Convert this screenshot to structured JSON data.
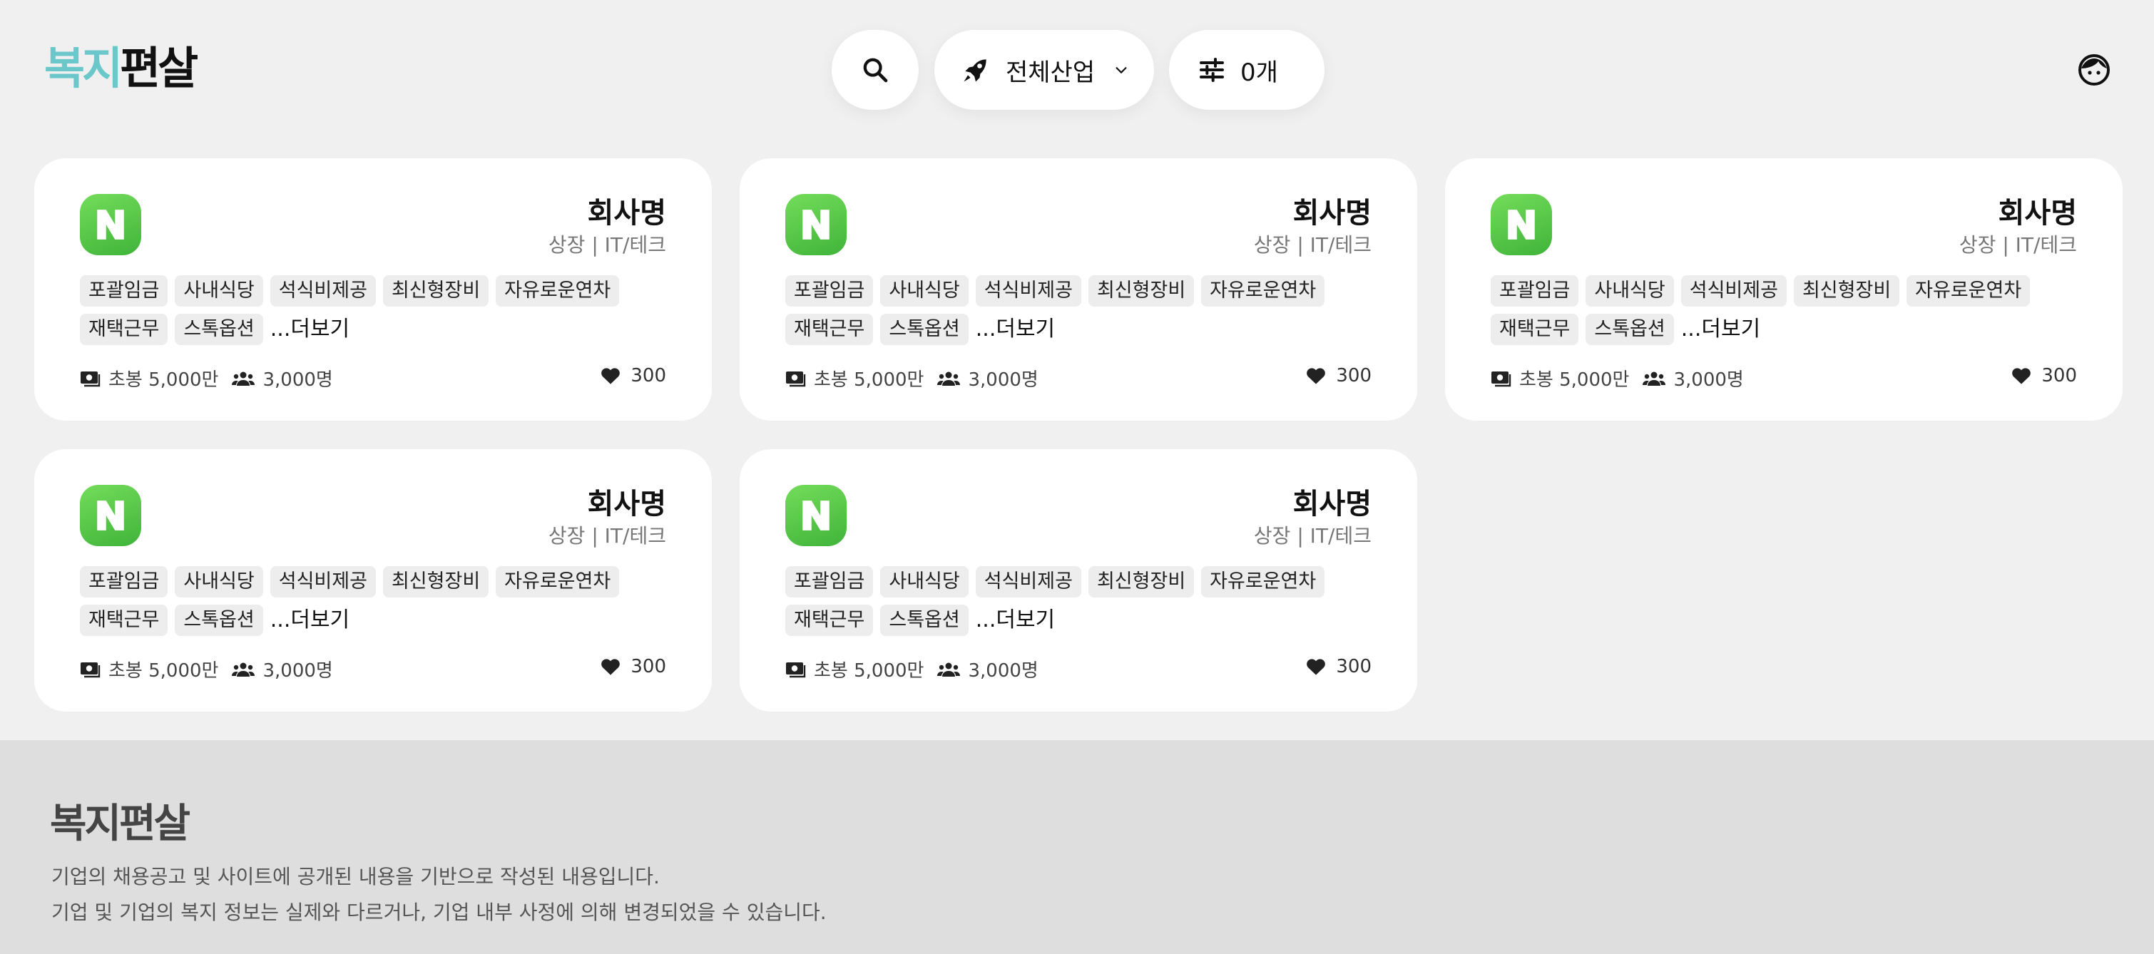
{
  "header": {
    "logo_part1": "복지",
    "logo_part2": "편살",
    "industry_label": "전체산업",
    "filter_label": "0개"
  },
  "cards": [
    {
      "name": "회사명",
      "meta": "상장 | IT/테크",
      "tags": [
        "포괄임금",
        "사내식당",
        "석식비제공",
        "최신형장비",
        "자유로운연차",
        "재택근무",
        "스톡옵션"
      ],
      "more": "...더보기",
      "salary": "초봉 5,000만",
      "employees": "3,000명",
      "likes": "300"
    },
    {
      "name": "회사명",
      "meta": "상장 | IT/테크",
      "tags": [
        "포괄임금",
        "사내식당",
        "석식비제공",
        "최신형장비",
        "자유로운연차",
        "재택근무",
        "스톡옵션"
      ],
      "more": "...더보기",
      "salary": "초봉 5,000만",
      "employees": "3,000명",
      "likes": "300"
    },
    {
      "name": "회사명",
      "meta": "상장 | IT/테크",
      "tags": [
        "포괄임금",
        "사내식당",
        "석식비제공",
        "최신형장비",
        "자유로운연차",
        "재택근무",
        "스톡옵션"
      ],
      "more": "...더보기",
      "salary": "초봉 5,000만",
      "employees": "3,000명",
      "likes": "300"
    },
    {
      "name": "회사명",
      "meta": "상장 | IT/테크",
      "tags": [
        "포괄임금",
        "사내식당",
        "석식비제공",
        "최신형장비",
        "자유로운연차",
        "재택근무",
        "스톡옵션"
      ],
      "more": "...더보기",
      "salary": "초봉 5,000만",
      "employees": "3,000명",
      "likes": "300"
    },
    {
      "name": "회사명",
      "meta": "상장 | IT/테크",
      "tags": [
        "포괄임금",
        "사내식당",
        "석식비제공",
        "최신형장비",
        "자유로운연차",
        "재택근무",
        "스톡옵션"
      ],
      "more": "...더보기",
      "salary": "초봉 5,000만",
      "employees": "3,000명",
      "likes": "300"
    }
  ],
  "footer": {
    "logo": "복지편살",
    "line1": "기업의 채용공고 및 사이트에 공개된 내용을 기반으로 작성된 내용입니다.",
    "line2": "기업 및 기업의 복지 정보는 실제와 다르거나, 기업 내부 사정에 의해 변경되었을 수 있습니다."
  },
  "colors": {
    "accent": "#6cc7cb",
    "naver_green": "#3fb43a",
    "background": "#f0f0f0",
    "footer_bg": "#dedede"
  },
  "icons": {
    "search": "search-icon",
    "industry": "rocket-icon",
    "dropdown": "chevron-down-icon",
    "filter": "sliders-icon",
    "profile": "profile-face-icon",
    "salary": "money-icon",
    "employees": "people-icon",
    "likes": "heart-icon"
  }
}
